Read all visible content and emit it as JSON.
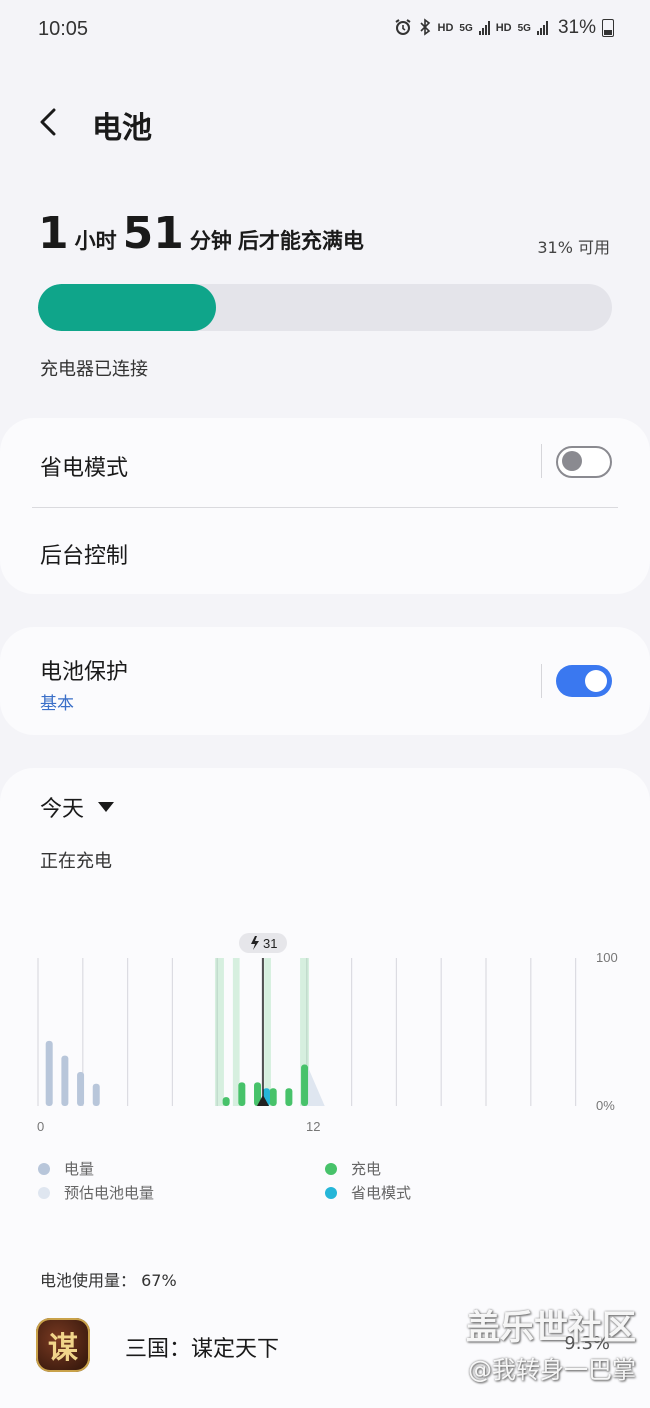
{
  "status": {
    "time": "10:05",
    "hd1": "HD",
    "net1": "5G",
    "hd2": "HD",
    "net2": "5G",
    "battery": "31%"
  },
  "header": {
    "title": "电池"
  },
  "summary": {
    "hours": "1",
    "hours_unit": "小时",
    "minutes": "51",
    "minutes_unit": "分钟",
    "suffix": "后才能充满电",
    "available": "31% 可用",
    "level": 0.31,
    "charger": "充电器已连接",
    "accent": "#0fa58a"
  },
  "power_card": {
    "saving_mode": "省电模式",
    "saving_on": false,
    "background": "后台控制"
  },
  "protect_card": {
    "label": "电池保护",
    "sub": "基本",
    "on": true
  },
  "chart_card": {
    "period": "今天",
    "state": "正在充电",
    "chart_data": {
      "type": "bar",
      "x_ticks": [
        "0",
        "12"
      ],
      "y_ticks": [
        "100",
        "0%"
      ],
      "marker": "31",
      "series": [
        {
          "name": "电量",
          "color": "#b8c6da",
          "points": [
            [
              0.5,
              44
            ],
            [
              1.2,
              34
            ],
            [
              1.9,
              23
            ],
            [
              2.6,
              15
            ]
          ]
        },
        {
          "name": "充电",
          "color": "#47c26a",
          "points": [
            [
              8.4,
              6
            ],
            [
              9.1,
              16
            ],
            [
              9.8,
              16
            ],
            [
              10.5,
              12
            ],
            [
              11.2,
              12
            ],
            [
              11.9,
              28
            ]
          ]
        },
        {
          "name": "省电模式",
          "color": "#25b6d8",
          "points": [
            [
              10.2,
              12
            ]
          ]
        }
      ],
      "estimate": {
        "name": "预估电池电量",
        "color": "#dfe6f0"
      },
      "ylim": [
        0,
        100
      ]
    },
    "legend": {
      "level": "电量",
      "estimate": "预估电池电量",
      "charging": "充电",
      "saving": "省电模式"
    }
  },
  "usage": {
    "label": "电池使用量：  67%",
    "app_icon_char": "谋",
    "app_name": "三国：谋定天下",
    "app_pct": "9.3%"
  },
  "watermark": {
    "line1": "盖乐世社区",
    "line2": "@我转身一巴掌"
  }
}
